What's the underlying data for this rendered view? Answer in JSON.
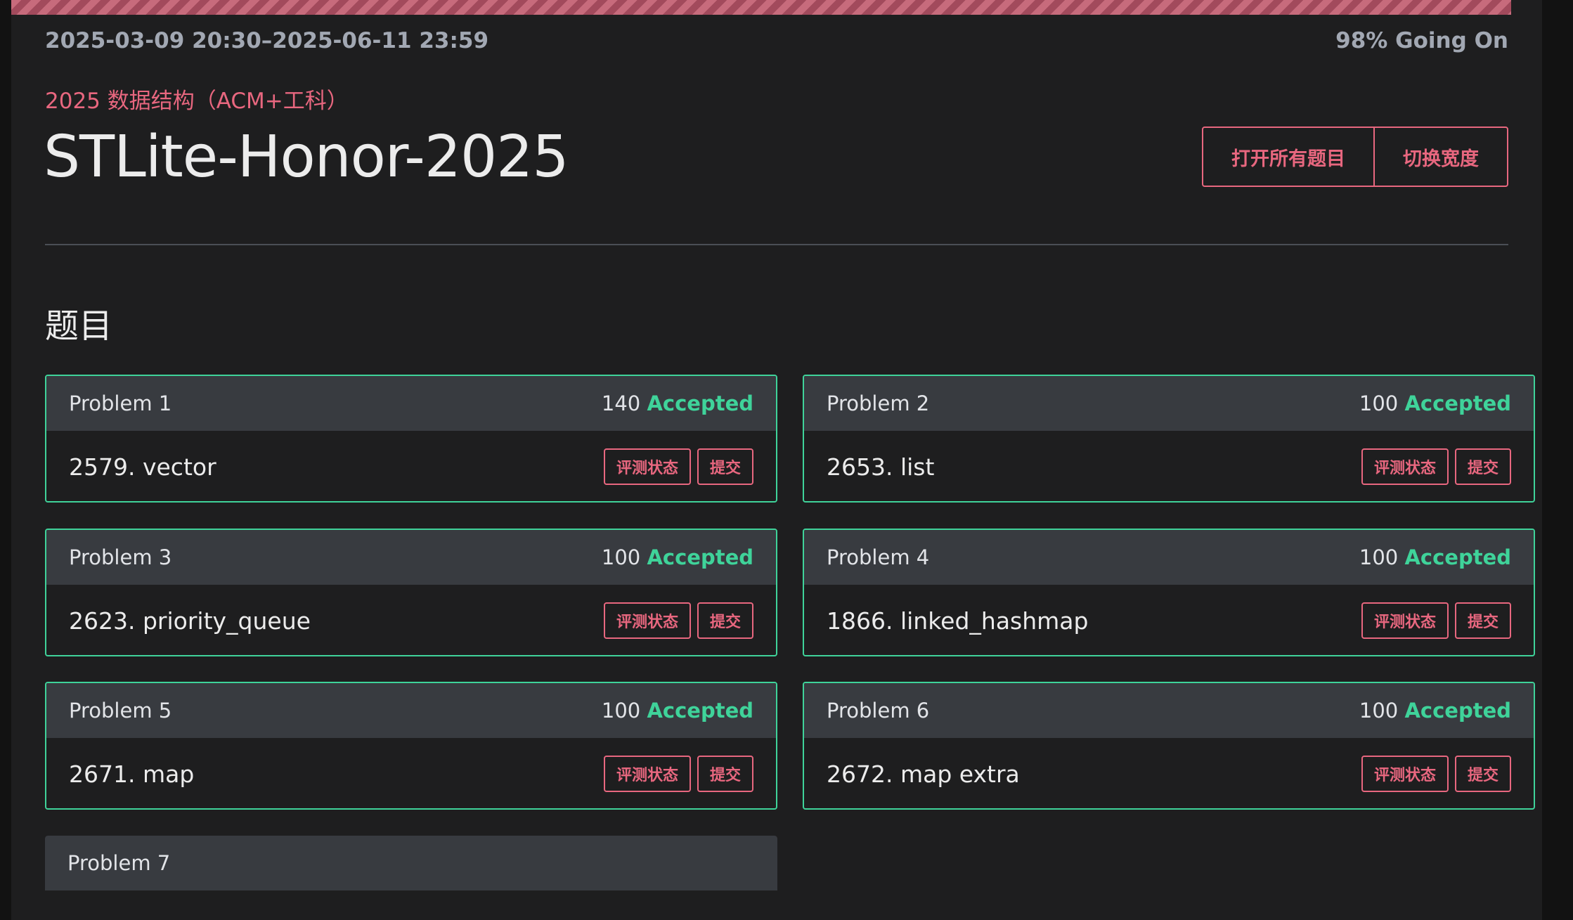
{
  "contest": {
    "time_range": "2025-03-09 20:30–2025-06-11 23:59",
    "status": "98% Going On",
    "progress_percent": 98,
    "course": "2025 数据结构（ACM+工科）",
    "title": "STLite-Honor-2025"
  },
  "toolbar": {
    "open_all_label": "打开所有题目",
    "toggle_width_label": "切换宽度"
  },
  "section": {
    "title": "题目"
  },
  "problems": [
    {
      "label": "Problem 1",
      "score": "140",
      "verdict": "Accepted",
      "name": "2579. vector",
      "status_btn": "评测状态",
      "submit_btn": "提交"
    },
    {
      "label": "Problem 2",
      "score": "100",
      "verdict": "Accepted",
      "name": "2653. list",
      "status_btn": "评测状态",
      "submit_btn": "提交"
    },
    {
      "label": "Problem 3",
      "score": "100",
      "verdict": "Accepted",
      "name": "2623. priority_queue",
      "status_btn": "评测状态",
      "submit_btn": "提交"
    },
    {
      "label": "Problem 4",
      "score": "100",
      "verdict": "Accepted",
      "name": "1866. linked_hashmap",
      "status_btn": "评测状态",
      "submit_btn": "提交"
    },
    {
      "label": "Problem 5",
      "score": "100",
      "verdict": "Accepted",
      "name": "2671. map",
      "status_btn": "评测状态",
      "submit_btn": "提交"
    },
    {
      "label": "Problem 6",
      "score": "100",
      "verdict": "Accepted",
      "name": "2672. map extra",
      "status_btn": "评测状态",
      "submit_btn": "提交"
    },
    {
      "label": "Problem 7"
    }
  ],
  "colors": {
    "accent": "#e8677f",
    "accepted": "#3fd39a",
    "background": "#1e1e1f",
    "card_header": "#383b40"
  }
}
